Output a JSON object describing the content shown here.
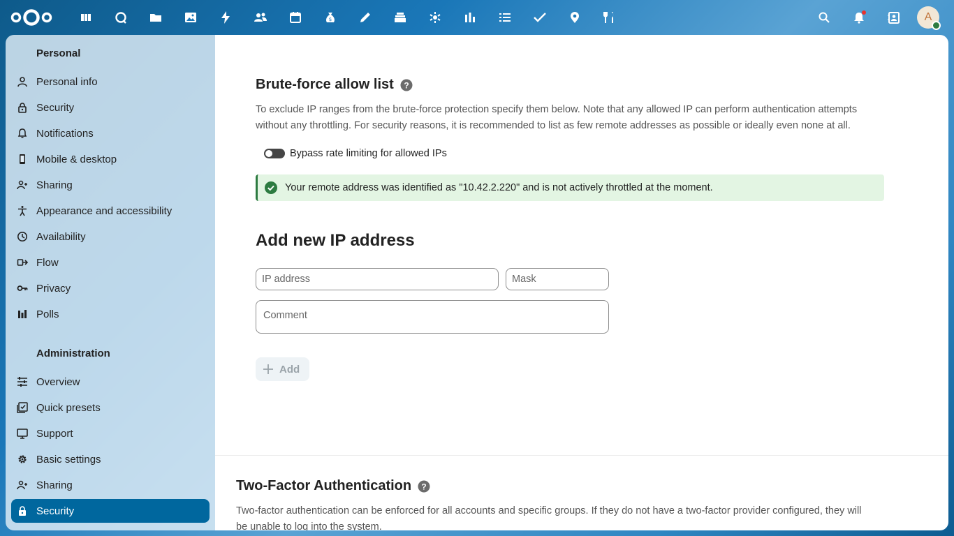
{
  "header": {
    "logo_icon": "nextcloud-logo",
    "apps": [
      {
        "name": "dashboard-icon"
      },
      {
        "name": "talk-icon"
      },
      {
        "name": "files-icon"
      },
      {
        "name": "photos-icon"
      },
      {
        "name": "activity-icon"
      },
      {
        "name": "contacts-icon"
      },
      {
        "name": "calendar-icon"
      },
      {
        "name": "money-icon"
      },
      {
        "name": "notes-icon"
      },
      {
        "name": "deck-icon"
      },
      {
        "name": "bug-icon"
      },
      {
        "name": "analytics-icon"
      },
      {
        "name": "tasks-list-icon"
      },
      {
        "name": "checkmark-icon"
      },
      {
        "name": "maps-icon"
      },
      {
        "name": "cookbook-icon"
      }
    ],
    "right_icons": [
      "search-icon",
      "notifications-icon",
      "contacts-menu-icon"
    ],
    "avatar_letter": "A",
    "status_color": "#2d7b41"
  },
  "sidebar": {
    "personal_heading": "Personal",
    "personal_items": [
      {
        "label": "Personal info",
        "icon": "account-icon"
      },
      {
        "label": "Security",
        "icon": "lock-icon"
      },
      {
        "label": "Notifications",
        "icon": "bell-icon"
      },
      {
        "label": "Mobile & desktop",
        "icon": "phone-icon"
      },
      {
        "label": "Sharing",
        "icon": "share-icon"
      },
      {
        "label": "Appearance and accessibility",
        "icon": "accessibility-icon"
      },
      {
        "label": "Availability",
        "icon": "clock-icon"
      },
      {
        "label": "Flow",
        "icon": "flow-icon"
      },
      {
        "label": "Privacy",
        "icon": "key-icon"
      },
      {
        "label": "Polls",
        "icon": "polls-icon"
      }
    ],
    "admin_heading": "Administration",
    "admin_items": [
      {
        "label": "Overview",
        "icon": "tune-icon"
      },
      {
        "label": "Quick presets",
        "icon": "presets-icon"
      },
      {
        "label": "Support",
        "icon": "monitor-icon"
      },
      {
        "label": "Basic settings",
        "icon": "gear-icon"
      },
      {
        "label": "Sharing",
        "icon": "share-icon"
      },
      {
        "label": "Security",
        "icon": "lock-icon",
        "active": true
      }
    ],
    "active_color": "#00679e"
  },
  "main": {
    "bruteforce": {
      "title": "Brute-force allow list",
      "description": "To exclude IP ranges from the brute-force protection specify them below. Note that any allowed IP can perform authentication attempts without any throttling. For security reasons, it is recommended to list as few remote addresses as possible or ideally even none at all.",
      "toggle_label": "Bypass rate limiting for allowed IPs",
      "toggle_on": false,
      "notice": "Your remote address was identified as \"10.42.2.220\" and is not actively throttled at the moment.",
      "notice_color": "#2d7b41"
    },
    "add_ip": {
      "title": "Add new IP address",
      "ip_placeholder": "IP address",
      "mask_placeholder": "Mask",
      "comment_placeholder": "Comment",
      "add_label": "Add"
    },
    "twofactor": {
      "title": "Two-Factor Authentication",
      "description": "Two-factor authentication can be enforced for all accounts and specific groups. If they do not have a two-factor provider configured, they will be unable to log into the system."
    }
  }
}
